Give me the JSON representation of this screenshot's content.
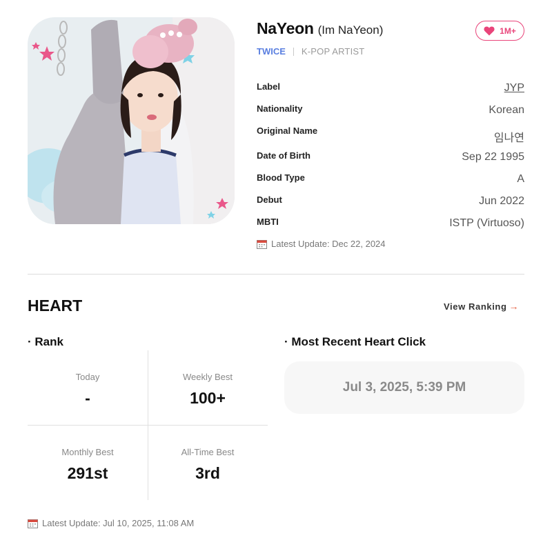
{
  "profile": {
    "name": "NaYeon",
    "real_name": "(Im NaYeon)",
    "group": "TWICE",
    "type": "K-POP ARTIST",
    "heart_count": "1M+",
    "accent_color": "#e9447a",
    "group_color": "#5a7fe0",
    "info": [
      {
        "key": "Label",
        "value": "JYP"
      },
      {
        "key": "Nationality",
        "value": "Korean"
      },
      {
        "key": "Original Name",
        "value": "임나연"
      },
      {
        "key": "Date of Birth",
        "value": "Sep 22 1995"
      },
      {
        "key": "Blood Type",
        "value": "A"
      },
      {
        "key": "Debut",
        "value": "Jun 2022"
      },
      {
        "key": "MBTI",
        "value": "ISTP (Virtuoso)"
      }
    ],
    "latest_update": "Latest Update: Dec 22, 2024"
  },
  "heart": {
    "title": "HEART",
    "view_ranking": "View Ranking",
    "rank_title": "· Rank",
    "recent_title": "· Most Recent Heart Click",
    "rank_cells": [
      {
        "label": "Today",
        "value": "-"
      },
      {
        "label": "Weekly Best",
        "value": "100+"
      },
      {
        "label": "Monthly Best",
        "value": "291st"
      },
      {
        "label": "All-Time Best",
        "value": "3rd"
      }
    ],
    "recent_click": "Jul 3, 2025, 5:39 PM",
    "latest_update": "Latest Update: Jul 10, 2025, 11:08 AM"
  }
}
